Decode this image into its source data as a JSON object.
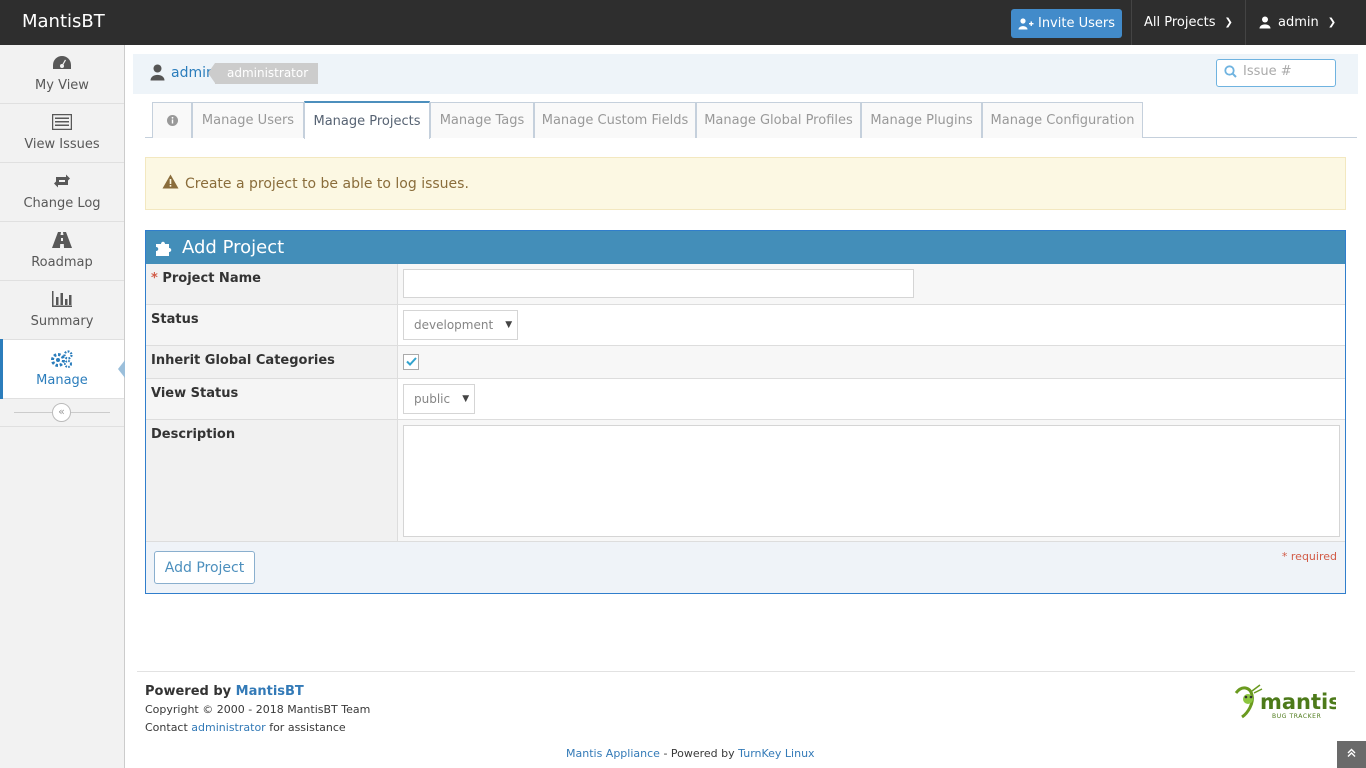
{
  "navbar": {
    "brand": "MantisBT",
    "invite_label": "Invite Users",
    "projects_label": "All Projects",
    "user_label": "admin"
  },
  "sidebar": {
    "items": [
      {
        "label": "My View",
        "icon": "dashboard-icon"
      },
      {
        "label": "View Issues",
        "icon": "list-icon"
      },
      {
        "label": "Change Log",
        "icon": "retweet-icon"
      },
      {
        "label": "Roadmap",
        "icon": "road-icon"
      },
      {
        "label": "Summary",
        "icon": "bar-chart-icon"
      },
      {
        "label": "Manage",
        "icon": "gears-icon"
      }
    ],
    "active": "Manage"
  },
  "breadcrumb": {
    "user": "admin",
    "role": "administrator",
    "search_placeholder": "Issue #"
  },
  "tabs": [
    {
      "label": ""
    },
    {
      "label": "Manage Users"
    },
    {
      "label": "Manage Projects"
    },
    {
      "label": "Manage Tags"
    },
    {
      "label": "Manage Custom Fields"
    },
    {
      "label": "Manage Global Profiles"
    },
    {
      "label": "Manage Plugins"
    },
    {
      "label": "Manage Configuration"
    }
  ],
  "alert": {
    "message": "Create a project to be able to log issues."
  },
  "form": {
    "title": "Add Project",
    "fields": {
      "project_name": {
        "label": "Project Name",
        "required_mark": "*",
        "value": ""
      },
      "status": {
        "label": "Status",
        "value": "development"
      },
      "inherit": {
        "label": "Inherit Global Categories",
        "checked": true
      },
      "view_status": {
        "label": "View Status",
        "value": "public"
      },
      "description": {
        "label": "Description",
        "value": ""
      }
    },
    "submit_label": "Add Project",
    "required_note": "* required"
  },
  "footer": {
    "powered_prefix": "Powered by",
    "powered_link": "MantisBT",
    "copyright": "Copyright © 2000 - 2018 MantisBT Team",
    "contact_prefix": "Contact",
    "contact_link": "administrator",
    "contact_suffix": "for assistance",
    "appliance_link": "Mantis Appliance",
    "appliance_mid": "- Powered by",
    "turnkey_link": "TurnKey Linux",
    "logo_text": "mantis",
    "logo_sub": "BUG TRACKER"
  },
  "colors": {
    "navbar": "#2e2e2e",
    "accent": "#438eb9",
    "link": "#337ab7",
    "warning_bg": "#fcf8e3",
    "required": "#d15b47"
  }
}
